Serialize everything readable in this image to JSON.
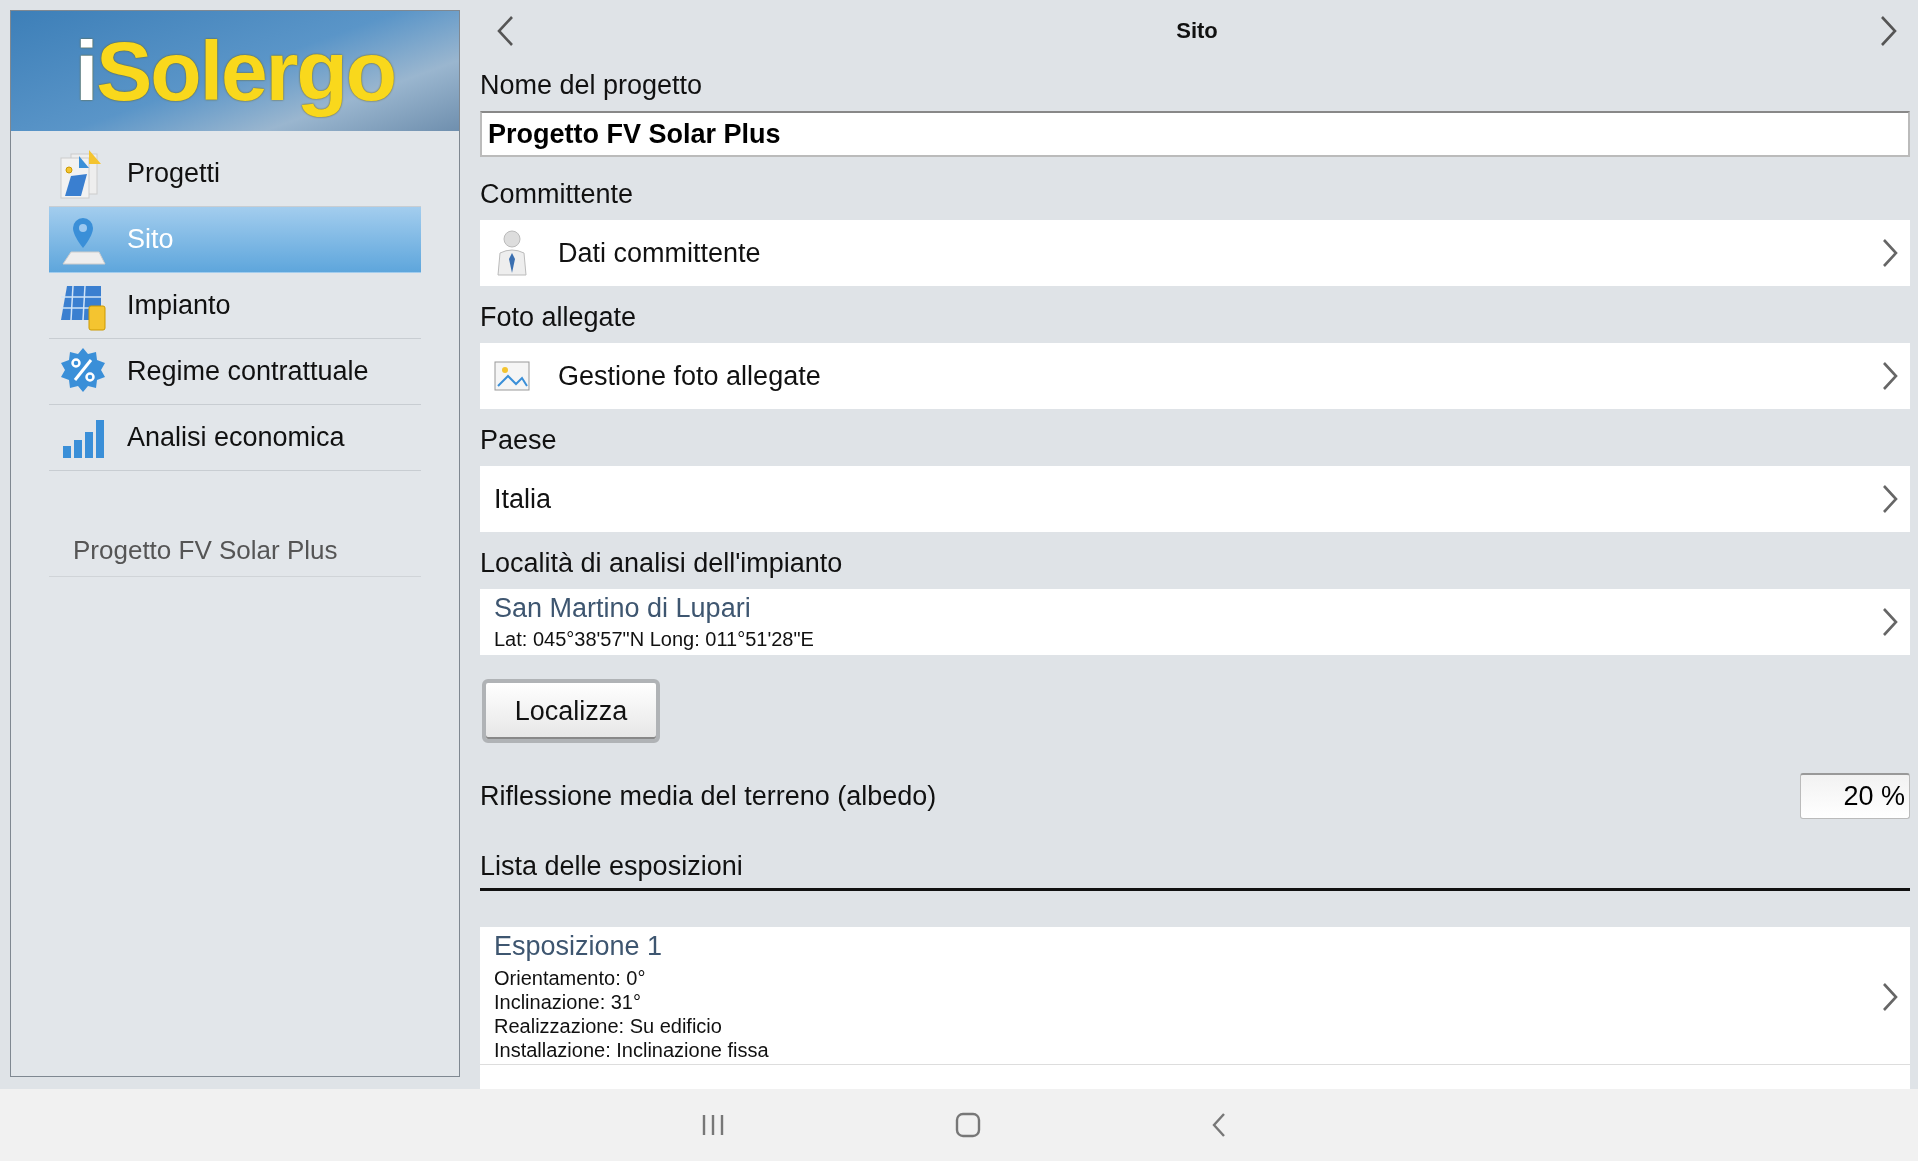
{
  "sidebar": {
    "logo": "iSolergo",
    "items": [
      {
        "label": "Progetti",
        "selected": false
      },
      {
        "label": "Sito",
        "selected": true
      },
      {
        "label": "Impianto",
        "selected": false
      },
      {
        "label": "Regime contrattuale",
        "selected": false
      },
      {
        "label": "Analisi economica",
        "selected": false
      }
    ],
    "project_name": "Progetto FV Solar Plus"
  },
  "header": {
    "title": "Sito"
  },
  "form": {
    "project_name": {
      "label": "Nome del progetto",
      "value": "Progetto FV Solar Plus"
    },
    "client": {
      "label": "Committente",
      "link": "Dati committente"
    },
    "photos": {
      "label": "Foto allegate",
      "link": "Gestione foto allegate"
    },
    "country": {
      "label": "Paese",
      "value": "Italia"
    },
    "location": {
      "label": "Località di analisi dell'impianto",
      "name": "San Martino di Lupari",
      "coords": "Lat: 045°38'57\"N Long: 011°51'28\"E"
    },
    "locate_button": "Localizza",
    "albedo": {
      "label": "Riflessione media del terreno (albedo)",
      "value": "20 %"
    }
  },
  "exposures": {
    "title": "Lista delle esposizioni",
    "items": [
      {
        "name": "Esposizione 1",
        "details": [
          "Orientamento: 0°",
          "Inclinazione: 31°",
          "Realizzazione: Su edificio",
          "Installazione: Inclinazione fissa"
        ]
      }
    ]
  }
}
